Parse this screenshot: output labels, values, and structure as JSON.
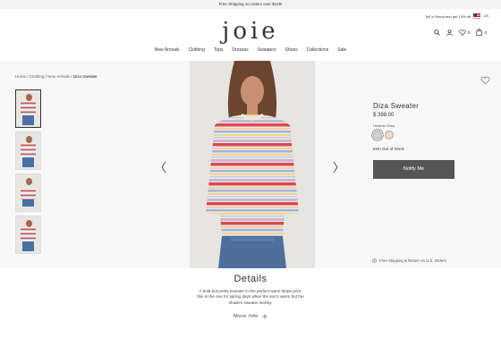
{
  "promo": {
    "text": "Free Shipping on orders over $125!"
  },
  "header": {
    "refer_text": "Tell a Friend and get 15% off",
    "locale": "US",
    "logo": "joie",
    "nav": [
      "New Arrivals",
      "Clothing",
      "Tops",
      "Dresses",
      "Sweaters",
      "Shoes",
      "Collections",
      "Sale"
    ],
    "wishlist_count": "0",
    "bag_count": "0"
  },
  "breadcrumb": {
    "items": [
      "Home",
      "Clothing",
      "New Arrivals"
    ],
    "separator": "/",
    "current": "Diza Sweater"
  },
  "product": {
    "name": "Diza Sweater",
    "price": "$ 398.00",
    "color_label": "Heather Grey",
    "stock_status": "Item Out of Stock",
    "notify_label": "Notify Me",
    "shipping_text": "Free Shipping & Return on U.S. Orders",
    "swatch_colors": [
      "#d2d2d2",
      "#f3d9c6"
    ]
  },
  "details": {
    "title": "Details",
    "text": "A bold but pretty sweater in the perfect warm stripe print, this is the one for spring days when the sun's warm but the shade's sweater worthy.",
    "more_info": "More Info"
  },
  "colors": {
    "button": "#555555",
    "panel": "#f7f7f7",
    "accent_red": "#d0585a"
  }
}
